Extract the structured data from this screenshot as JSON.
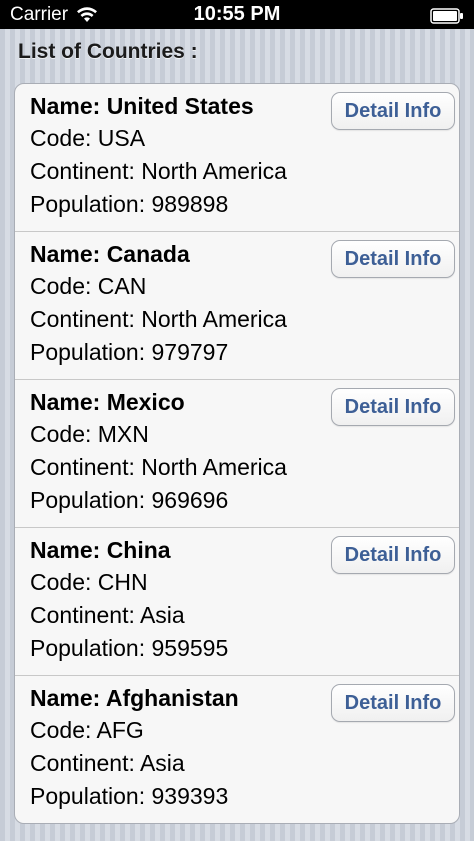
{
  "status_bar": {
    "carrier": "Carrier",
    "time": "10:55 PM"
  },
  "header": {
    "title": "List of Countries :"
  },
  "countries": [
    {
      "name": "Name: United States",
      "code": "Code: USA",
      "continent": "Continent: North America",
      "population": "Population: 989898",
      "button": "Detail Info"
    },
    {
      "name": "Name: Canada",
      "code": "Code: CAN",
      "continent": "Continent: North America",
      "population": "Population: 979797",
      "button": "Detail Info"
    },
    {
      "name": "Name: Mexico",
      "code": "Code: MXN",
      "continent": "Continent: North America",
      "population": "Population: 969696",
      "button": "Detail Info"
    },
    {
      "name": "Name: China",
      "code": "Code: CHN",
      "continent": "Continent: Asia",
      "population": "Population: 959595",
      "button": "Detail Info"
    },
    {
      "name": "Name: Afghanistan",
      "code": "Code: AFG",
      "continent": "Continent: Asia",
      "population": "Population: 939393",
      "button": "Detail Info"
    }
  ],
  "icons": {
    "wifi": "wifi-icon",
    "battery": "battery-icon"
  },
  "colors": {
    "button_text": "#3d5f96",
    "status_bar": "#000000"
  }
}
